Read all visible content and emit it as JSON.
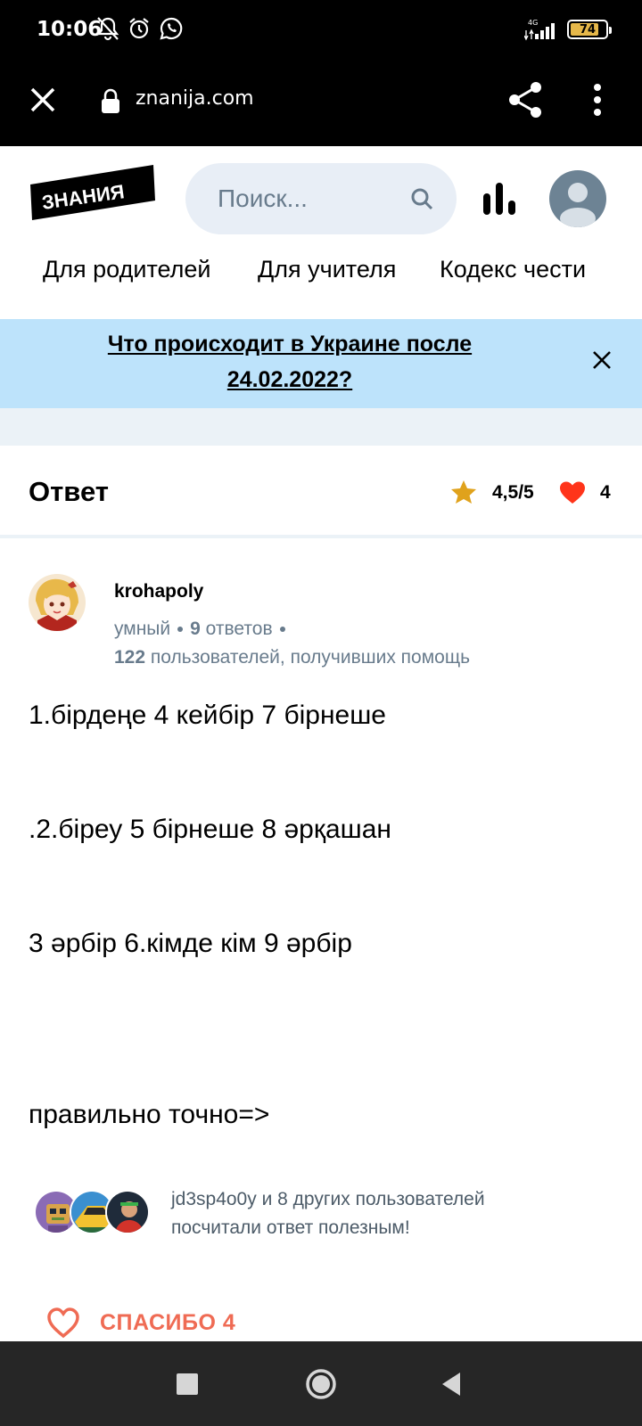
{
  "status_bar": {
    "time": "10:06",
    "battery": "74",
    "network": "4G",
    "icons": [
      "mute-icon",
      "alarm-icon",
      "whatsapp-icon",
      "signal-icon",
      "battery-icon"
    ]
  },
  "browser": {
    "url": "znanija.com",
    "icons": [
      "close-icon",
      "lock-icon",
      "share-icon",
      "more-icon"
    ]
  },
  "header": {
    "logo_text": "ЗНАНИЯ",
    "search_placeholder": "Поиск...",
    "nav": [
      "Для родителей",
      "Для учителя",
      "Кодекс чести"
    ]
  },
  "banner": {
    "line1": "Что происходит в Украине после",
    "line2": "24.02.2022?"
  },
  "answer": {
    "title": "Ответ",
    "rating": "4,5/5",
    "likes": "4",
    "author": {
      "name": "krohapoly",
      "rank": "умный",
      "answers_count": "9",
      "answers_label": "ответов",
      "helped_count": "122",
      "helped_label": "пользователей, получивших помощь"
    },
    "lines": [
      "1.бірдеңе 4 кейбір 7 бірнеше",
      ".2.біреу 5 бірнеше 8 әрқашан",
      "3 әрбір 6.кімде кім 9 әрбір",
      "правильно точно=>"
    ],
    "helpful_line1": "jd3sp4o0y и 8 других пользователей",
    "helpful_line2": "посчитали ответ полезным!",
    "thanks_label": "СПАСИБО 4"
  },
  "colors": {
    "banner_bg": "#bde3fb",
    "search_bg": "#e8eef6",
    "star": "#f5a623",
    "heart": "#ff341a",
    "thanks": "#ef6b54",
    "muted": "#687b8c"
  }
}
